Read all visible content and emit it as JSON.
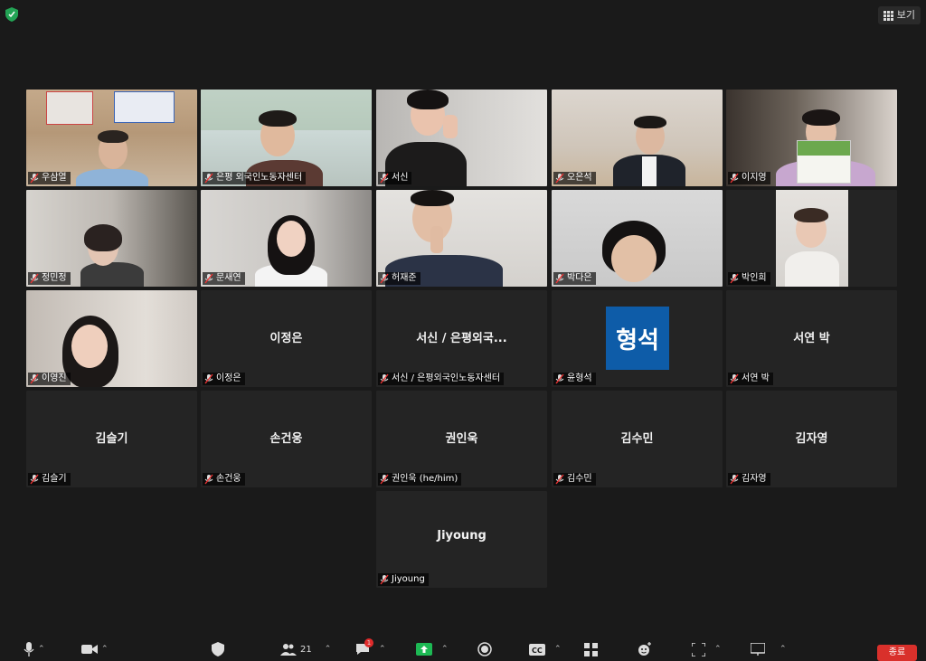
{
  "topbar": {
    "view_label": "보기"
  },
  "tiles": [
    {
      "name": "우삼열"
    },
    {
      "name": "은평 외국인노동자센터"
    },
    {
      "name": "서신"
    },
    {
      "name": "오은석"
    },
    {
      "name": "이지영"
    },
    {
      "name": "정민정"
    },
    {
      "name": "문새연"
    },
    {
      "name": "허재준"
    },
    {
      "name": "박다은"
    },
    {
      "name": "박인희"
    },
    {
      "name": "이영진"
    },
    {
      "name": "이정은",
      "display": "이정은"
    },
    {
      "name": "서신 / 은평외국인노동자센터",
      "display": "서신 / 은평외국..."
    },
    {
      "name": "윤형석",
      "avatar": "형석"
    },
    {
      "name": "서연 박",
      "display": "서연 박"
    },
    {
      "name": "김슬기",
      "display": "김슬기"
    },
    {
      "name": "손건웅",
      "display": "손건웅"
    },
    {
      "name": "권인욱 (he/him)",
      "display": "권인욱"
    },
    {
      "name": "김수민",
      "display": "김수민"
    },
    {
      "name": "김자영",
      "display": "김자영"
    },
    {
      "name": "Jiyoung",
      "display": "Jiyoung"
    }
  ],
  "toolbar": {
    "participants_count": "21",
    "chat_badge": "1",
    "end_label": "종료"
  },
  "colors": {
    "active_speaker": "#b9d56b",
    "end_button": "#d9302b",
    "avatar": "#0e5ca8"
  }
}
